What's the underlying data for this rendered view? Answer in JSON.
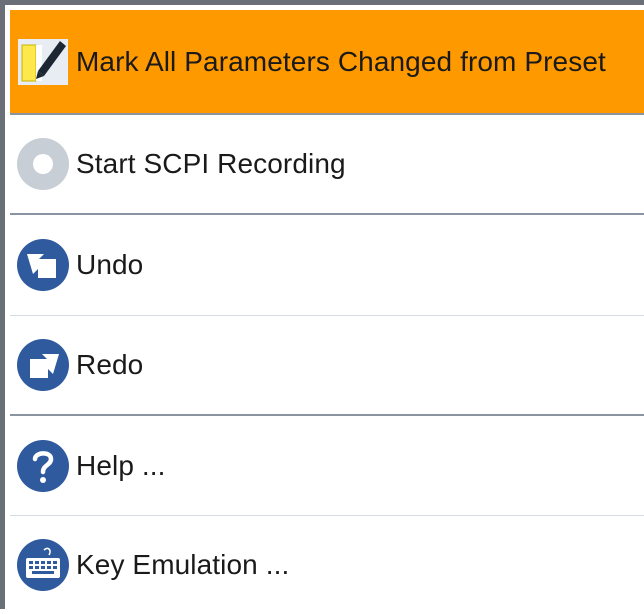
{
  "menu": {
    "items": [
      {
        "label": "Mark All Parameters Changed from Preset",
        "icon": "pencil-mark-icon",
        "active": true
      },
      {
        "label": "Start SCPI Recording",
        "icon": "record-icon",
        "active": false
      },
      {
        "label": "Undo",
        "icon": "undo-icon",
        "active": false
      },
      {
        "label": "Redo",
        "icon": "redo-icon",
        "active": false
      },
      {
        "label": "Help ...",
        "icon": "help-icon",
        "active": false
      },
      {
        "label": "Key Emulation ...",
        "icon": "keyboard-icon",
        "active": false
      }
    ],
    "colors": {
      "active_bg": "#ff9900",
      "icon_blue": "#2f5b9e",
      "record_gray": "#c7ced6"
    }
  }
}
